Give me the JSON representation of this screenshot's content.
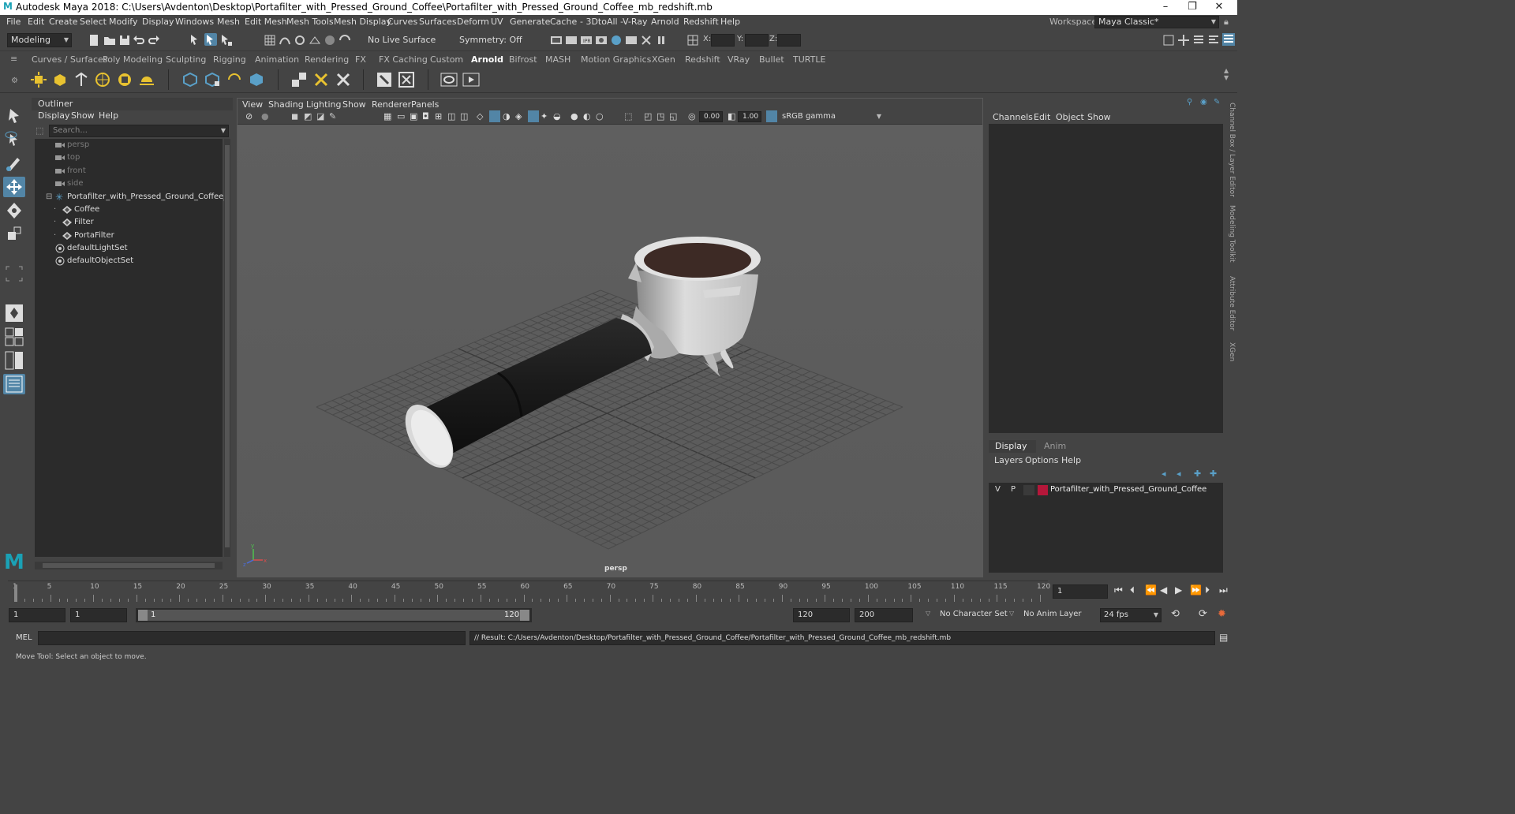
{
  "window": {
    "title": "Autodesk Maya 2018: C:\\Users\\Avdenton\\Desktop\\Portafilter_with_Pressed_Ground_Coffee\\Portafilter_with_Pressed_Ground_Coffee_mb_redshift.mb",
    "minimize": "–",
    "maximize": "❐",
    "close": "✕"
  },
  "menubar": {
    "items": [
      "File",
      "Edit",
      "Create",
      "Select",
      "Modify",
      "Display",
      "Windows",
      "Mesh",
      "Edit Mesh",
      "Mesh Tools",
      "Mesh Display",
      "Curves",
      "Surfaces",
      "Deform",
      "UV",
      "Generate",
      "Cache",
      "- 3DtoAll -",
      "V-Ray",
      "Arnold",
      "Redshift",
      "Help"
    ],
    "workspace_label": "Workspace :",
    "workspace_value": "Maya Classic*"
  },
  "toolbar": {
    "mode": "Modeling",
    "live_surface": "No Live Surface",
    "symmetry": "Symmetry: Off",
    "x_label": "X:",
    "y_label": "Y:",
    "z_label": "Z:"
  },
  "shelf": {
    "tabs": [
      "Curves / Surfaces",
      "Poly Modeling",
      "Sculpting",
      "Rigging",
      "Animation",
      "Rendering",
      "FX",
      "FX Caching",
      "Custom",
      "Arnold",
      "Bifrost",
      "MASH",
      "Motion Graphics",
      "XGen",
      "Redshift",
      "VRay",
      "Bullet",
      "TURTLE"
    ],
    "active_tab": "Arnold"
  },
  "outliner": {
    "title": "Outliner",
    "menu": [
      "Display",
      "Show",
      "Help"
    ],
    "search_placeholder": "Search...",
    "items": [
      {
        "label": "persp",
        "type": "camera"
      },
      {
        "label": "top",
        "type": "camera"
      },
      {
        "label": "front",
        "type": "camera"
      },
      {
        "label": "side",
        "type": "camera"
      },
      {
        "label": "Portafilter_with_Pressed_Ground_Coffee_",
        "type": "group"
      },
      {
        "label": "Coffee",
        "type": "mesh"
      },
      {
        "label": "Filter",
        "type": "mesh"
      },
      {
        "label": "PortaFilter",
        "type": "mesh"
      },
      {
        "label": "defaultLightSet",
        "type": "set"
      },
      {
        "label": "defaultObjectSet",
        "type": "set"
      }
    ]
  },
  "viewport": {
    "menu": [
      "View",
      "Shading",
      "Lighting",
      "Show",
      "Renderer",
      "Panels"
    ],
    "exposure": "0.00",
    "gamma": "1.00",
    "color_space": "sRGB gamma",
    "camera_label": "persp"
  },
  "channelbox": {
    "menu": [
      "Channels",
      "Edit",
      "Object",
      "Show"
    ]
  },
  "layers": {
    "tabs": [
      "Display",
      "Anim"
    ],
    "menu": [
      "Layers",
      "Options",
      "Help"
    ],
    "rows": [
      {
        "v": "V",
        "p": "P",
        "color": "#b5173a",
        "name": "Portafilter_with_Pressed_Ground_Coffee"
      }
    ]
  },
  "side_tabs": [
    "Channel Box / Layer Editor",
    "Modeling Toolkit",
    "Attribute Editor",
    "XGen"
  ],
  "timeline": {
    "ticks": [
      "1",
      "5",
      "10",
      "15",
      "20",
      "25",
      "30",
      "35",
      "40",
      "45",
      "50",
      "55",
      "60",
      "65",
      "70",
      "75",
      "80",
      "85",
      "90",
      "95",
      "100",
      "105",
      "110",
      "115",
      "120"
    ],
    "current_frame": "1"
  },
  "range": {
    "start_field": "1",
    "current_field": "1",
    "range_start": "1",
    "range_end": "120",
    "end_field": "120",
    "max_field": "200",
    "character_set": "No Character Set",
    "anim_layer": "No Anim Layer",
    "fps": "24 fps"
  },
  "command": {
    "label": "MEL",
    "result": "// Result: C:/Users/Avdenton/Desktop/Portafilter_with_Pressed_Ground_Coffee/Portafilter_with_Pressed_Ground_Coffee_mb_redshift.mb"
  },
  "status": {
    "help_line": "Move Tool: Select an object to move."
  }
}
